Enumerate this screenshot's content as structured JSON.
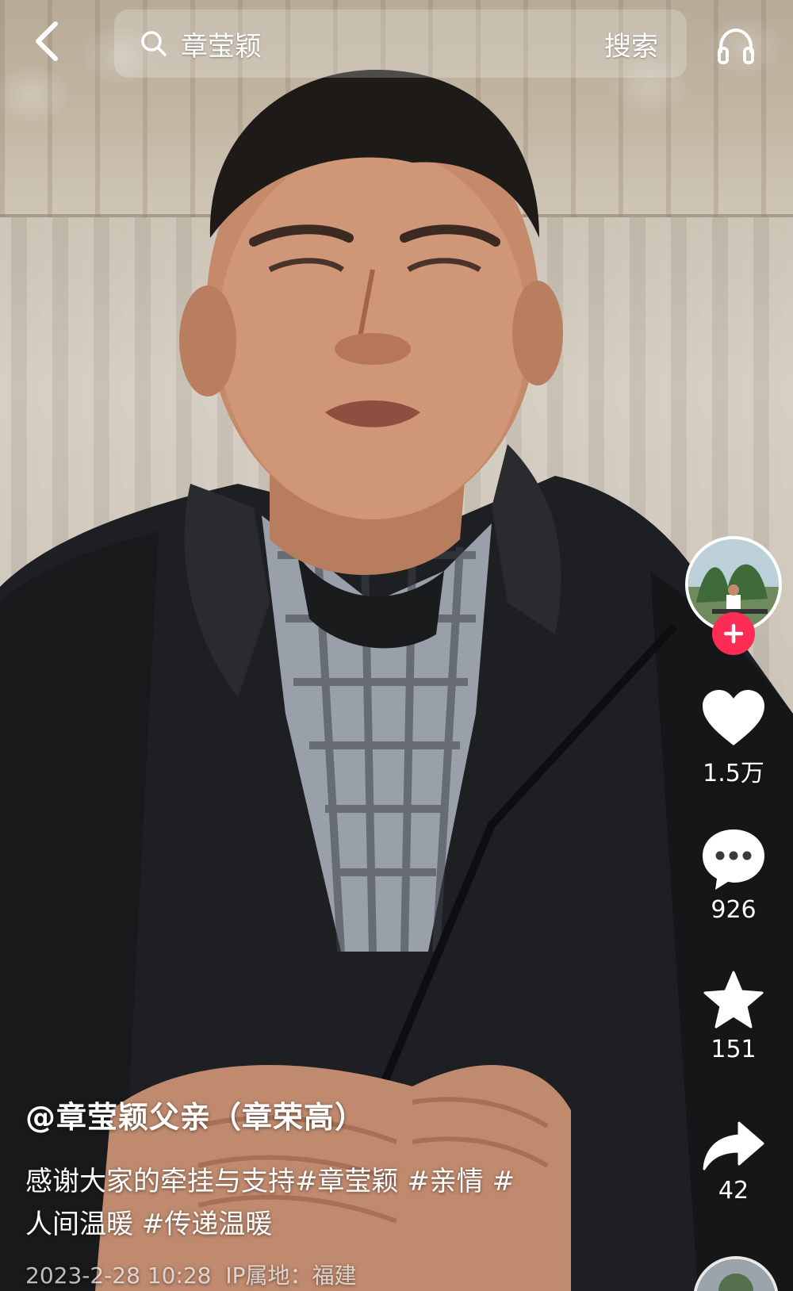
{
  "top_bar": {
    "back_icon": "chevron-left-icon",
    "search_icon": "search-icon",
    "search_query": "章莹颖",
    "search_button_label": "搜索",
    "listen_icon": "headphones-icon"
  },
  "author_panel": {
    "avatar_icon": "avatar-image",
    "follow_icon": "plus-icon",
    "follow_color": "#fe2c55"
  },
  "actions": {
    "like": {
      "icon": "heart-icon",
      "count": "1.5万"
    },
    "comment": {
      "icon": "comment-bubble-icon",
      "count": "926"
    },
    "favorite": {
      "icon": "star-icon",
      "count": "151"
    },
    "share": {
      "icon": "share-arrow-icon",
      "count": "42"
    }
  },
  "caption": {
    "author": "@章莹颖父亲（章荣高）",
    "text_prefix": "感谢大家的牵挂与支持",
    "hashtags": [
      "#章莹颖",
      "#亲情",
      "#人间温暖",
      "#传递温暖"
    ],
    "tag_separator_1": " ",
    "tag_separator_2": " ",
    "tag_line2_lead": "#",
    "tag_line2_rest": "人间温暖",
    "timestamp": "2023-2-28 10:28",
    "ip_location": "IP属地：福建"
  },
  "colors": {
    "accent": "#fe2c55",
    "text_primary": "#ffffff"
  }
}
